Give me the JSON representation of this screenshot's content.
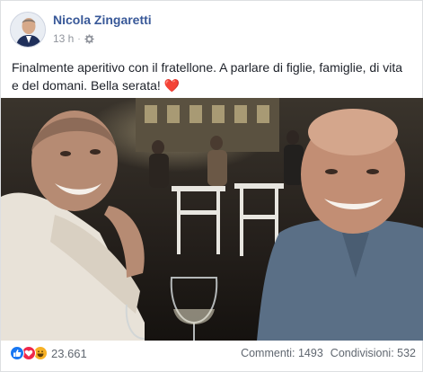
{
  "post": {
    "author": "Nicola Zingaretti",
    "time": "13 h",
    "separator": "·",
    "text": "Finalmente aperitivo con il fratellone. A parlare di figlie, famiglie, di vita e del domani. Bella serata!",
    "emoji": "❤️"
  },
  "icons": {
    "audience": "gear-icon",
    "reactions": [
      "like-icon",
      "love-icon",
      "haha-icon"
    ]
  },
  "colors": {
    "author_link": "#385898",
    "like": "#1877f2",
    "love": "#f0284a",
    "haha": "#f7b125",
    "heart": "#e0245e"
  },
  "stats": {
    "reactions_count": "23.661",
    "comments": "Commenti: 1493",
    "shares": "Condivisioni: 532"
  }
}
